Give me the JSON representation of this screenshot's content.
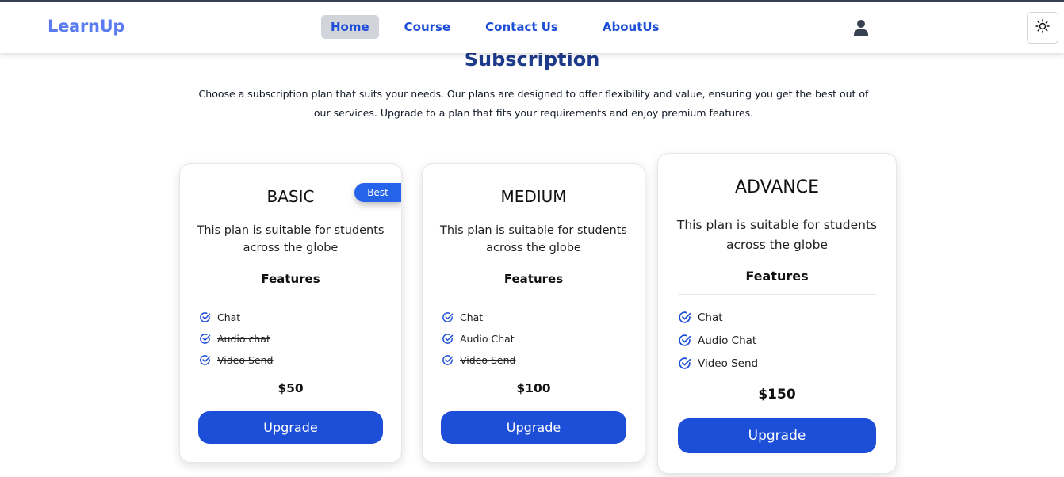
{
  "brand": {
    "logo_text": "LearnUp",
    "accent_color": "#1d4ed8"
  },
  "nav": {
    "items": [
      {
        "label": "Home",
        "active": true
      },
      {
        "label": "Course",
        "active": false
      },
      {
        "label": "Contact Us",
        "active": false
      },
      {
        "label": "AboutUs",
        "active": false
      }
    ],
    "user_icon": "user-icon",
    "theme_icon": "sun-icon"
  },
  "page": {
    "title": "Subscription",
    "description": "Choose a subscription plan that suits your needs. Our plans are designed to offer flexibility and value, ensuring you get the best out of our services. Upgrade to a plan that fits your requirements and enjoy premium features."
  },
  "plans": [
    {
      "name": "BASIC",
      "badge": "Best",
      "description": "This plan is suitable for students across the globe",
      "features_title": "Features",
      "features": [
        {
          "label": "Chat",
          "included": true
        },
        {
          "label": "Audio chat",
          "included": false
        },
        {
          "label": "Video Send",
          "included": false
        }
      ],
      "price": "$50",
      "button_label": "Upgrade"
    },
    {
      "name": "MEDIUM",
      "description": "This plan is suitable for students across the globe",
      "features_title": "Features",
      "features": [
        {
          "label": "Chat",
          "included": true
        },
        {
          "label": "Audio Chat",
          "included": true
        },
        {
          "label": "Video Send",
          "included": false
        }
      ],
      "price": "$100",
      "button_label": "Upgrade"
    },
    {
      "name": "ADVANCE",
      "description": "This plan is suitable for students across the globe",
      "features_title": "Features",
      "features": [
        {
          "label": "Chat",
          "included": true
        },
        {
          "label": "Audio Chat",
          "included": true
        },
        {
          "label": "Video Send",
          "included": true
        }
      ],
      "price": "$150",
      "button_label": "Upgrade"
    }
  ]
}
